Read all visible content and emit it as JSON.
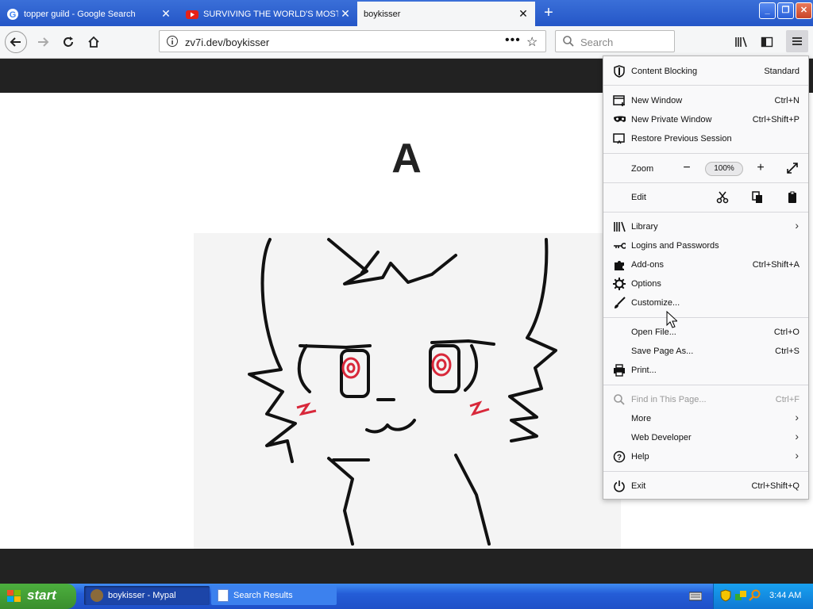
{
  "browser": {
    "tabs": [
      {
        "title": "topper guild - Google Search",
        "favicon": "google-icon"
      },
      {
        "title": "SURVIVING THE WORLD'S MOST E",
        "favicon": "youtube-icon"
      },
      {
        "title": "boykisser",
        "favicon": "none",
        "active": true
      }
    ],
    "url": "zv7i.dev/boykisser",
    "search_placeholder": "Search"
  },
  "page": {
    "heading": "A",
    "image_desc": "black line drawing of a cat-like character with red eyes and blushing cheeks"
  },
  "menu": {
    "content_blocking": {
      "label": "Content Blocking",
      "value": "Standard"
    },
    "new_window": {
      "label": "New Window",
      "shortcut": "Ctrl+N"
    },
    "new_private_window": {
      "label": "New Private Window",
      "shortcut": "Ctrl+Shift+P"
    },
    "restore_session": {
      "label": "Restore Previous Session"
    },
    "zoom": {
      "label": "Zoom",
      "value": "100%"
    },
    "edit": {
      "label": "Edit"
    },
    "library": {
      "label": "Library"
    },
    "logins": {
      "label": "Logins and Passwords"
    },
    "addons": {
      "label": "Add-ons",
      "shortcut": "Ctrl+Shift+A"
    },
    "options": {
      "label": "Options"
    },
    "customize": {
      "label": "Customize..."
    },
    "open_file": {
      "label": "Open File...",
      "shortcut": "Ctrl+O"
    },
    "save_page": {
      "label": "Save Page As...",
      "shortcut": "Ctrl+S"
    },
    "print": {
      "label": "Print..."
    },
    "find": {
      "label": "Find in This Page...",
      "shortcut": "Ctrl+F"
    },
    "more": {
      "label": "More"
    },
    "web_developer": {
      "label": "Web Developer"
    },
    "help": {
      "label": "Help"
    },
    "exit": {
      "label": "Exit",
      "shortcut": "Ctrl+Shift+Q"
    }
  },
  "taskbar": {
    "start_label": "start",
    "items": [
      {
        "label": "boykisser - Mypal"
      },
      {
        "label": "Search Results"
      }
    ],
    "clock": "3:44 AM"
  },
  "colors": {
    "taskbar_blue": "#245dd7",
    "start_green": "#3a8f2d",
    "eye_red": "#d8283a"
  }
}
